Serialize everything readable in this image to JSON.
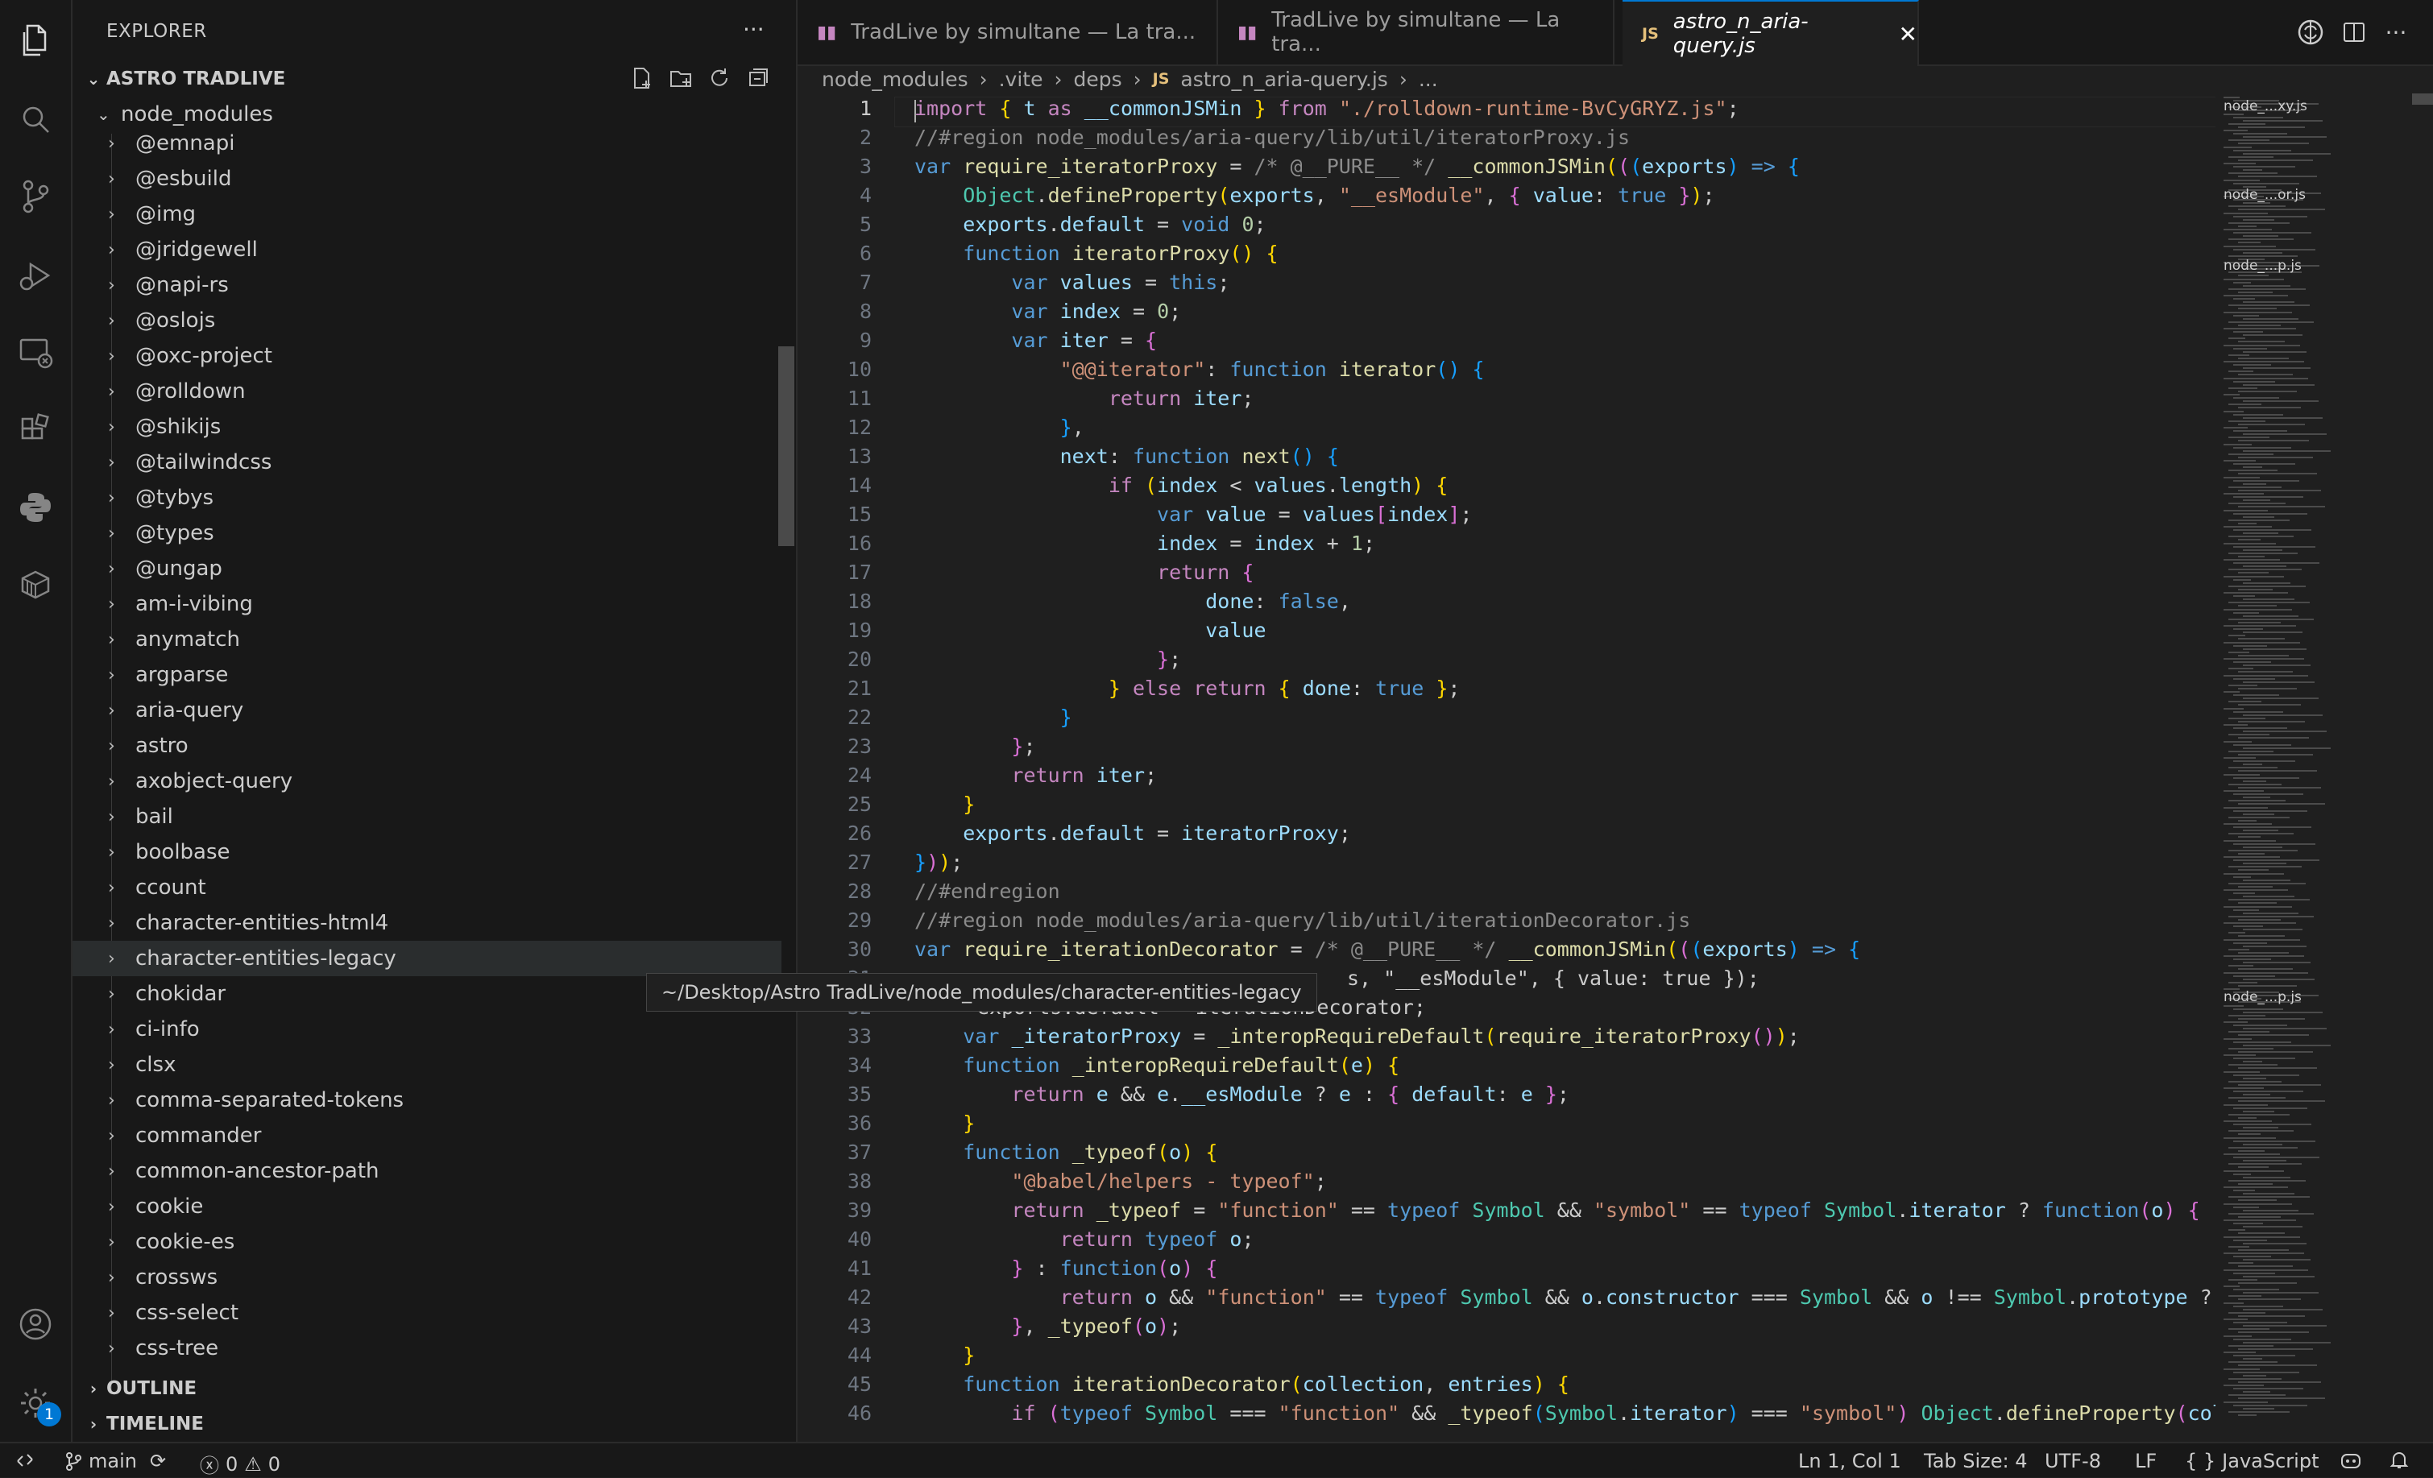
{
  "sidebar": {
    "title": "EXPLORER",
    "project_title": "ASTRO TRADLIVE",
    "folder": "node_modules",
    "items": [
      "@emnapi",
      "@esbuild",
      "@img",
      "@jridgewell",
      "@napi-rs",
      "@oslojs",
      "@oxc-project",
      "@rolldown",
      "@shikijs",
      "@tailwindcss",
      "@tybys",
      "@types",
      "@ungap",
      "am-i-vibing",
      "anymatch",
      "argparse",
      "aria-query",
      "astro",
      "axobject-query",
      "bail",
      "boolbase",
      "ccount",
      "character-entities-html4",
      "character-entities-legacy",
      "chokidar",
      "ci-info",
      "clsx",
      "comma-separated-tokens",
      "commander",
      "common-ancestor-path",
      "cookie",
      "cookie-es",
      "crossws",
      "css-select",
      "css-tree"
    ],
    "selected_item": "character-entities-legacy",
    "outline_label": "OUTLINE",
    "timeline_label": "TIMELINE"
  },
  "activity_badge": "1",
  "tabs": [
    {
      "label": "TradLive by simultane — La tra...",
      "icon": "preview-icon"
    },
    {
      "label": "TradLive by simultane — La tra...",
      "icon": "preview-icon"
    },
    {
      "label": "astro_n_aria-query.js",
      "icon": "JS"
    }
  ],
  "breadcrumb": [
    "node_modules",
    ".vite",
    "deps",
    "astro_n_aria-query.js",
    "..."
  ],
  "breadcrumb_js_icon": "JS",
  "tooltip": "~/Desktop/Astro TradLive/node_modules/character-entities-legacy",
  "minimap_labels": [
    "node_...xy.js",
    "node_...or.js",
    "node_...p.js",
    "node_...p.js"
  ],
  "code": {
    "line_numbers": [
      "1",
      "2",
      "3",
      "4",
      "5",
      "6",
      "7",
      "8",
      "9",
      "10",
      "11",
      "12",
      "13",
      "14",
      "15",
      "16",
      "17",
      "18",
      "19",
      "20",
      "21",
      "22",
      "23",
      "24",
      "25",
      "26",
      "27",
      "28",
      "29",
      "30",
      "31",
      "32",
      "33",
      "34",
      "35",
      "36",
      "37",
      "38",
      "39",
      "40",
      "41",
      "42",
      "43",
      "44",
      "45",
      "46"
    ],
    "line_31_tail": "s, \"__esModule\", { value: true });",
    "line_32_tail": "exports.default = iterationDecorator;"
  },
  "status": {
    "branch": "main",
    "errors": "0",
    "warnings": "0",
    "position": "Ln 1, Col 1",
    "tab_size": "Tab Size: 4",
    "encoding": "UTF-8",
    "eol": "LF",
    "language": "JavaScript"
  }
}
